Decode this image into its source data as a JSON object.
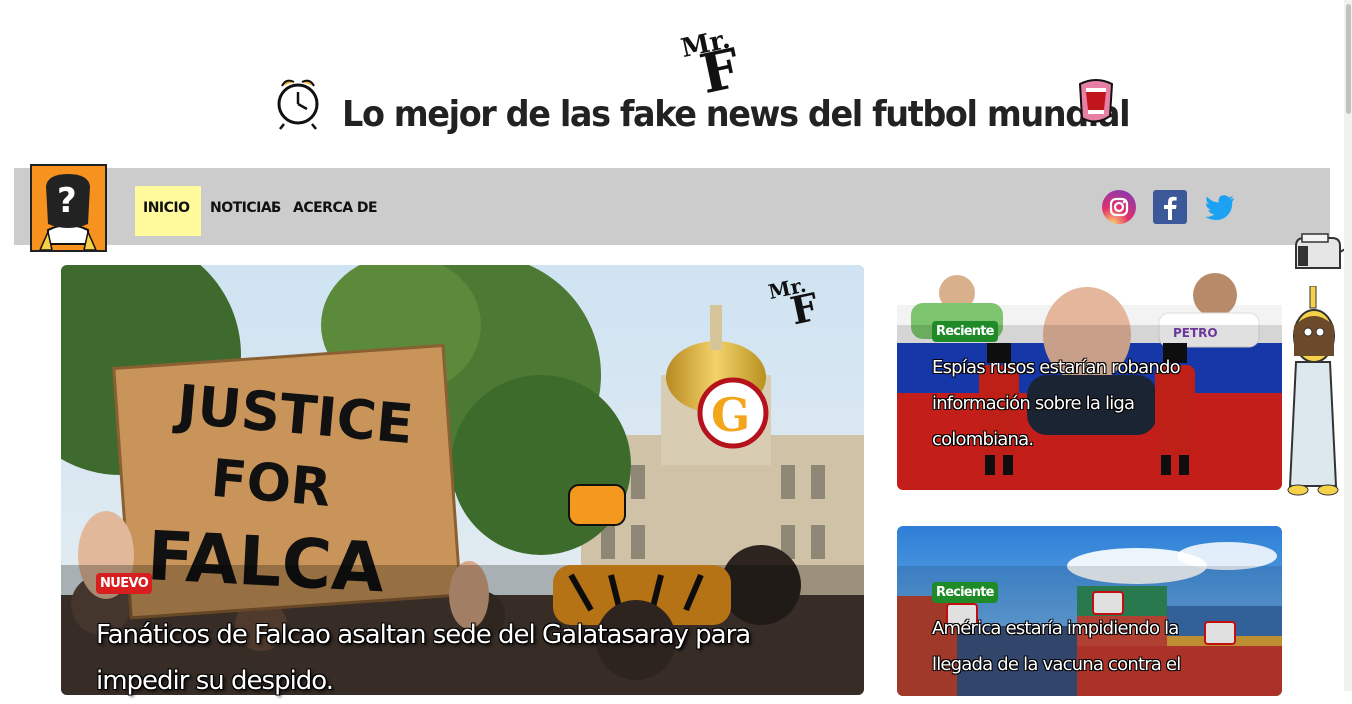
{
  "header": {
    "logo_text": "Mr. F",
    "tagline": "Lo mejor de las fake news del futbol mundial"
  },
  "nav": {
    "items": [
      {
        "label": "INICIO",
        "active": true
      },
      {
        "label": "NOTICIAS"
      },
      {
        "label": "ACERCA DE"
      }
    ],
    "separator": "I"
  },
  "social": [
    {
      "icon": "instagram-icon",
      "color": "#c13584"
    },
    {
      "icon": "facebook-icon",
      "color": "#3b5998"
    },
    {
      "icon": "twitter-icon",
      "color": "#1da1f2"
    }
  ],
  "hero": {
    "sign_text": [
      "JUSTICE",
      "FOR",
      "FALCA"
    ],
    "badge": "NUEVO",
    "title": "Fanáticos de Falcao asaltan sede del Galatasaray para impedir su despido."
  },
  "side_articles": [
    {
      "badge": "Reciente",
      "title": "Espías rusos estarían robando información sobre la liga colombiana."
    },
    {
      "badge": "Reciente",
      "title": "América estaría impidiendo la llegada de la vacuna contra el"
    }
  ],
  "colors": {
    "nav_bg": "#cccccc",
    "active_nav_bg": "#fffb9d",
    "badge_new": "#d81e1e",
    "badge_recent": "#1e8a28"
  }
}
